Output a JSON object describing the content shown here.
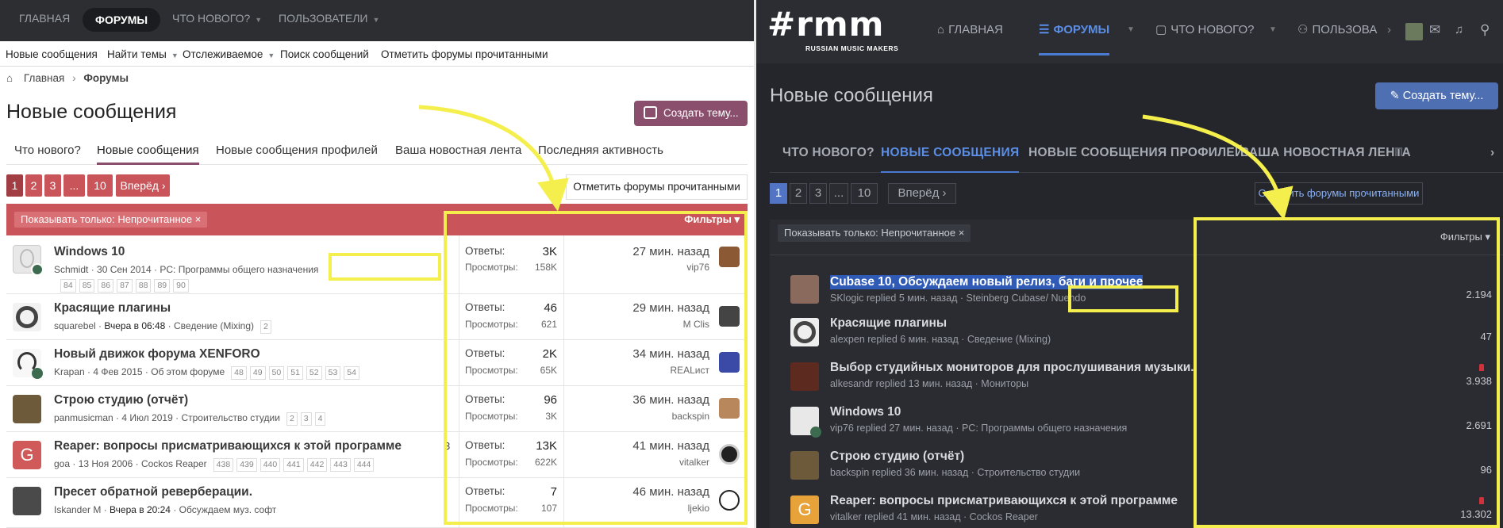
{
  "left": {
    "nav": {
      "home": "ГЛАВНАЯ",
      "forums": "ФОРУМЫ",
      "whats_new": "ЧТО НОВОГО?",
      "users": "ПОЛЬЗОВАТЕЛИ"
    },
    "subnav": {
      "new_posts": "Новые сообщения",
      "find_threads": "Найти темы",
      "watched": "Отслеживаемое",
      "search_posts": "Поиск сообщений",
      "mark_read": "Отметить форумы прочитанными"
    },
    "breadcrumb": {
      "home": "Главная",
      "forums": "Форумы"
    },
    "title": "Новые сообщения",
    "create_button": "Создать тему...",
    "tabs": [
      "Что нового?",
      "Новые сообщения",
      "Новые сообщения профилей",
      "Ваша новостная лента",
      "Последняя активность"
    ],
    "pager": {
      "pages": [
        "1",
        "2",
        "3",
        "...",
        "10"
      ],
      "next": "Вперёд ›"
    },
    "mark_read_button": "Отметить форумы прочитанными",
    "filter": {
      "chip": "Показывать только: Непрочитанное ×",
      "filters": "Фильтры ▾"
    },
    "replies_label": "Ответы:",
    "views_label": "Просмотры:",
    "threads": [
      {
        "title": "Windows 10",
        "author": "Schmidt",
        "date": "30 Сен 2014",
        "forum": "PC: Программы общего назначения",
        "pages": [
          "84",
          "85",
          "86",
          "87",
          "88",
          "89",
          "90"
        ],
        "replies": "3K",
        "views": "158K",
        "last_time": "27 мин. назад",
        "last_user": "vip76"
      },
      {
        "title": "Красящие плагины",
        "author": "squarebel",
        "date": "Вчера в 06:48",
        "forum": "Сведение (Mixing)",
        "pages": [
          "2"
        ],
        "replies": "46",
        "views": "621",
        "last_time": "29 мин. назад",
        "last_user": "M Clis"
      },
      {
        "title": "Новый движок форума XENFORO",
        "author": "Krapan",
        "date": "4 Фев 2015",
        "forum": "Об этом форуме",
        "pages": [
          "48",
          "49",
          "50",
          "51",
          "52",
          "53",
          "54"
        ],
        "replies": "2K",
        "views": "65K",
        "last_time": "34 мин. назад",
        "last_user": "REALист"
      },
      {
        "title": "Строю студию (отчёт)",
        "author": "panmusicman",
        "date": "4 Июл 2019",
        "forum": "Строительство студии",
        "pages": [
          "2",
          "3",
          "4"
        ],
        "replies": "96",
        "views": "3K",
        "last_time": "36 мин. назад",
        "last_user": "backspin"
      },
      {
        "title": "Reaper: вопросы присматривающихся к этой программе",
        "author": "goa",
        "date": "13 Ноя 2006",
        "forum": "Cockos Reaper",
        "pages": [
          "438",
          "439",
          "440",
          "441",
          "442",
          "443",
          "444"
        ],
        "replies": "13K",
        "views": "622K",
        "last_time": "41 мин. назад",
        "last_user": "vitalker",
        "avatar_letter": "G"
      },
      {
        "title": "Пресет обратной реверберации.",
        "author": "Iskander M",
        "date": "Вчера в 20:24",
        "forum": "Обсуждаем муз. софт",
        "pages": [],
        "replies": "7",
        "views": "107",
        "last_time": "46 мин. назад",
        "last_user": "ljekio"
      }
    ],
    "stray_mark": "3"
  },
  "right": {
    "logo": {
      "main": "#rmm",
      "tagline": "RUSSIAN MUSIC MAKERS"
    },
    "nav": {
      "home": "ГЛАВНАЯ",
      "forums": "ФОРУМЫ",
      "whats_new": "ЧТО НОВОГО?",
      "users": "ПОЛЬЗОВА"
    },
    "title": "Новые сообщения",
    "create_button": "✎ Создать тему...",
    "tabs": [
      "ЧТО НОВОГО?",
      "НОВЫЕ СООБЩЕНИЯ",
      "НОВЫЕ СООБЩЕНИЯ ПРОФИЛЕЙ",
      "ВАША НОВОСТНАЯ ЛЕНТА",
      "П"
    ],
    "pager": {
      "pages": [
        "1",
        "2",
        "3",
        "...",
        "10"
      ],
      "next": "Вперёд ›"
    },
    "mark_read_button": "Отметить форумы прочитанными",
    "filter": {
      "chip": "Показывать только: Непрочитанное ×",
      "filters": "Фильтры ▾"
    },
    "threads": [
      {
        "title": "Cubase 10, Обсуждаем новый релиз, баги и прочее",
        "meta": "SKlogic replied 5 мин. назад · Steinberg Cubase/ Nuendo",
        "count": "2.194",
        "hot": false
      },
      {
        "title": "Красящие плагины",
        "meta": "alexpen replied 6 мин. назад · Сведение (Mixing)",
        "count": "47",
        "hot": false
      },
      {
        "title": "Выбор студийных мониторов для прослушивания музыки.",
        "meta": "alkesandr replied 13 мин. назад · Мониторы",
        "count": "3.938",
        "hot": true
      },
      {
        "title": "Windows 10",
        "meta": "vip76 replied 27 мин. назад · PC: Программы общего назначения",
        "count": "2.691",
        "hot": false
      },
      {
        "title": "Строю студию (отчёт)",
        "meta": "backspin replied 36 мин. назад · Строительство студии",
        "count": "96",
        "hot": false
      },
      {
        "title": "Reaper: вопросы присматривающихся к этой программе",
        "meta": "vitalker replied 41 мин. назад · Cockos Reaper",
        "count": "13.302",
        "hot": true,
        "avatar_letter": "G"
      }
    ]
  },
  "colors": {
    "left_accent": "#c9555a",
    "left_brand": "#8a4f6d",
    "right_accent": "#4a7ad1",
    "highlight": "#f4ef4c"
  }
}
